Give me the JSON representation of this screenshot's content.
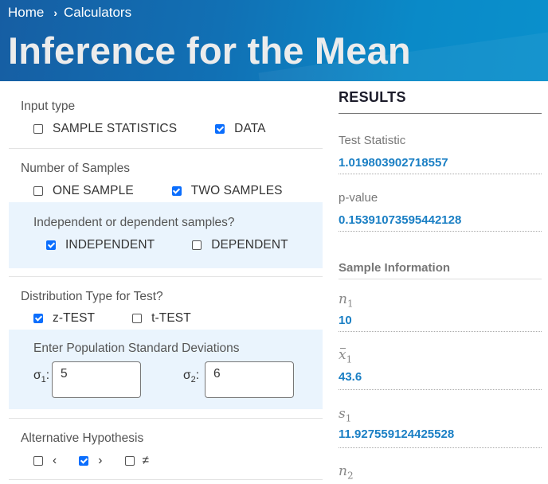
{
  "breadcrumb": {
    "items": [
      "Home",
      "Calculators"
    ],
    "separator": "›"
  },
  "page": {
    "title": "Inference for the Mean"
  },
  "form": {
    "input_type": {
      "label": "Input type",
      "options": [
        {
          "label": "SAMPLE STATISTICS",
          "checked": false
        },
        {
          "label": "DATA",
          "checked": true
        }
      ]
    },
    "num_samples": {
      "label": "Number of Samples",
      "options": [
        {
          "label": "ONE SAMPLE",
          "checked": false
        },
        {
          "label": "TWO SAMPLES",
          "checked": true
        }
      ]
    },
    "dependence": {
      "label": "Independent or dependent samples?",
      "options": [
        {
          "label": "INDEPENDENT",
          "checked": true
        },
        {
          "label": "DEPENDENT",
          "checked": false
        }
      ]
    },
    "distribution": {
      "label": "Distribution Type for Test?",
      "options": [
        {
          "label": "z-TEST",
          "checked": true
        },
        {
          "label": "t-TEST",
          "checked": false
        }
      ]
    },
    "std_devs": {
      "label": "Enter Population Standard Deviations",
      "sigma1_symbol": "σ",
      "sigma1_sub": "1",
      "sigma1_value": "5",
      "sigma2_symbol": "σ",
      "sigma2_sub": "2",
      "sigma2_value": "6",
      "colon": ":"
    },
    "alternative": {
      "label": "Alternative Hypothesis",
      "options": [
        {
          "label": "‹",
          "checked": false
        },
        {
          "label": "›",
          "checked": true
        },
        {
          "label": "≠",
          "checked": false
        }
      ]
    }
  },
  "results": {
    "title": "RESULTS",
    "test_statistic_label": "Test Statistic",
    "test_statistic_value": "1.019803902718557",
    "p_value_label": "p-value",
    "p_value_value": "0.15391073595442128",
    "sample_info_heading": "Sample Information",
    "n1": {
      "symbol": "n",
      "sub": "1",
      "value": "10"
    },
    "xbar1": {
      "symbol": "x",
      "sub": "1",
      "value": "43.6"
    },
    "s1": {
      "symbol": "s",
      "sub": "1",
      "value": "11.927559124425528"
    },
    "n2": {
      "symbol": "n",
      "sub": "2"
    }
  },
  "colors": {
    "accent": "#0b6efd",
    "result_value": "#1a7fc4",
    "panel_bg": "#eaf4fd",
    "header_start": "#165ea3",
    "header_end": "#0a90cc"
  }
}
